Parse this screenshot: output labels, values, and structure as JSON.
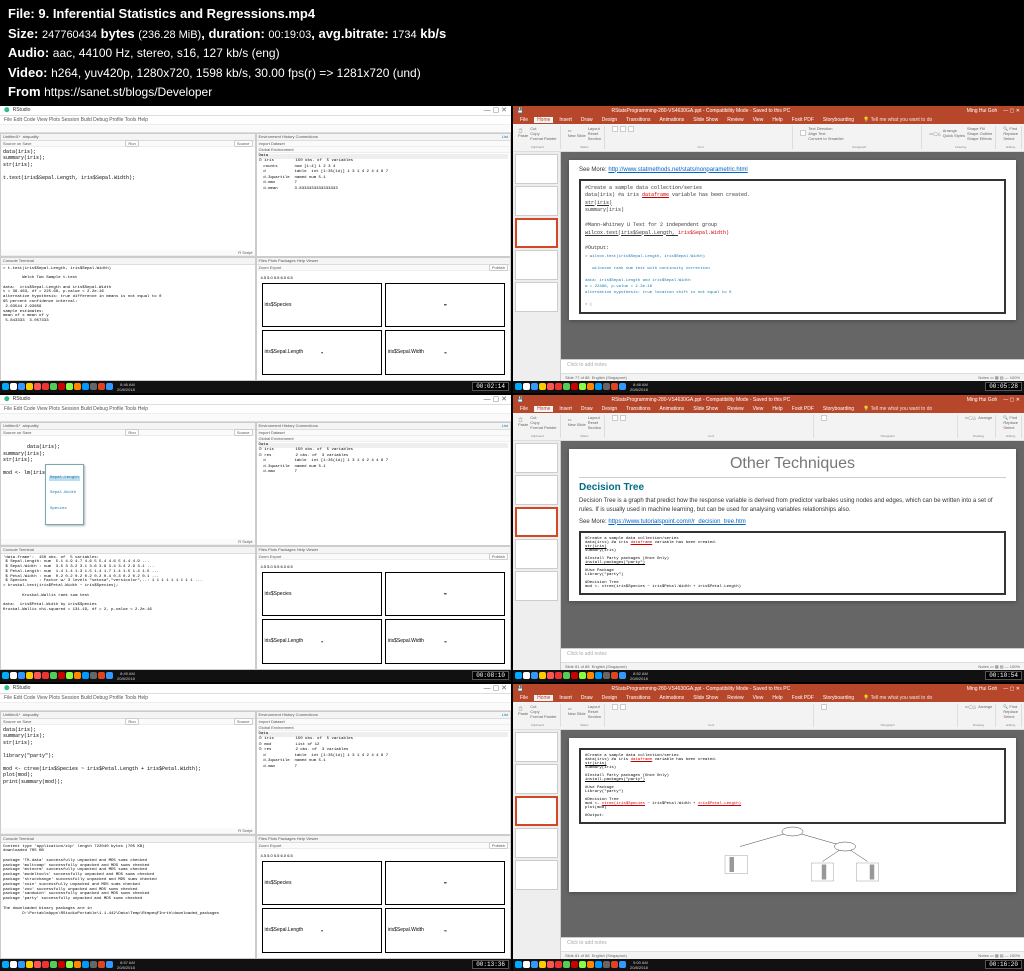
{
  "header": {
    "file_label": "File:",
    "file_name": "9. Inferential Statistics and Regressions.mp4",
    "size_label": "Size:",
    "size_bytes": "247760434",
    "size_unit": "bytes",
    "size_mib": "(236.28 MiB)",
    "duration_label": ", duration:",
    "duration": "00:19:03",
    "bitrate_label": ", avg.bitrate:",
    "bitrate": "1734",
    "bitrate_unit": "kb/s",
    "audio_label": "Audio:",
    "audio": "aac, 44100 Hz, stereo, s16, 127 kb/s (eng)",
    "video_label": "Video:",
    "video": "h264, yuv420p, 1280x720, 1598 kb/s, 30.00 fps(r) => 1281x720 (und)",
    "from_label": "From",
    "from_url": "https://sanet.st/blogs/Developer"
  },
  "rstudio": {
    "app_title": "RStudio",
    "menu": "File  Edit  Code  View  Plots  Session  Build  Debug  Profile  Tools  Help",
    "project_label": "Project: (None)",
    "source_tab": "Untitled1*",
    "source_tab2": "airquality",
    "source_on_save": "Source on Save",
    "run": "Run",
    "source": "Source",
    "env_tabs": "Environment   History   Connections",
    "import": "Import Dataset",
    "global_env": "Global Environment",
    "list": "List",
    "data_hdr": "Data",
    "values_hdr": "Values",
    "console_tabs": "Console   Terminal",
    "plots_tabs": "Files   Plots   Packages   Help   Viewer",
    "zoom": "Zoom",
    "export": "Export",
    "publish": "Publish",
    "rscript": "R Script"
  },
  "panel1": {
    "code": "data(iris);\nsummary(iris);\nstr(iris);\n\nt.test(iris$Sepal.Length, iris$Sepal.Width);",
    "console": "> t.test(iris$Sepal.Length, iris$Sepal.Width)\n\n        Welch Two Sample t-test\n\ndata:  iris$Sepal.Length and iris$Sepal.Width\nt = 36.463, df = 225.68, p-value < 2.2e-16\nalternative hypothesis: true difference in means is not equal to 0\n95 percent confidence interval:\n 2.63544 2.93656\nsample estimates:\nmean of x mean of y\n 5.843333  3.057333",
    "env": "⊙ iris         150 obs. of  5 variables\n  counts       num [1:4] 1 2 3 4\n  d            table  int [1:35(1d)] 1 3 1 4 2 4 4 6 7\n  d.3quartile  named num 5.1\n  d.max        7\n  d.mean       3.8333333333333333",
    "plot1": "iris$Species",
    "plot2": "iris$Sepal.Length",
    "plot3": "iris$Sepal.Width",
    "axis": "4.5  5.0  5.5  6.0  6.5",
    "timestamp": "00:02:14",
    "clock": "8:46 AM\n20/8/2018"
  },
  "panel2": {
    "code": "data(iris);\nsummary(iris);\nstr(iris);\n\nmod <- lm(iris$",
    "hint1": "Sepal.Length",
    "hint2": "Sepal.Width",
    "hint3": "Species",
    "console": "'data.frame':  150 obs. of  5 variables:\n $ Sepal.Length: num  5.1 4.9 4.7 4.6 5 5.4 4.6 5 4.4 4.9 ...\n $ Sepal.Width : num  3.5 3 3.2 3.1 3.6 3.9 3.4 3.4 2.9 3.1 ...\n $ Petal.Length: num  1.4 1.4 1.3 1.5 1.4 1.7 1.4 1.5 1.4 1.5 ...\n $ Petal.Width : num  0.2 0.2 0.2 0.2 0.2 0.4 0.3 0.2 0.2 0.1 ...\n $ Species     : Factor w/ 3 levels \"setosa\",\"versicolor\",..: 1 1 1 1 1 1 1 1 1 ...\n> kruskal.test(iris$Petal.Width ~ iris$Species);\n\n        Kruskal-Wallis rank sum test\n\ndata:  iris$Petal.Width by iris$Species\nKruskal-Wallis chi-squared = 131.19, df = 2, p-value < 2.2e-16",
    "env": "⊙ iris         150 obs. of  5 variables\n⊙ res          2 obs. of  3 variables\n  d            table  int [1:35(1d)] 1 3 1 4 2 4 4 6 7\n  d.3quartile  named num 5.1\n  d.max        7",
    "plot1": "iris$Species",
    "plot2": "iris$Sepal.Length",
    "plot3": "iris$Sepal.Width",
    "axis": "4.5  5.0  5.5  6.0  6.5",
    "timestamp": "00:08:10",
    "clock": "8:49 AM\n20/8/2018"
  },
  "panel3": {
    "code": "data(iris);\nsummary(iris);\nstr(iris);\n\nlibrary(\"party\");\n\nmod <- ctree(iris$Species ~ iris$Petal.Length + iris$Petal.Width);\nplot(mod);\nprint(summary(mod));",
    "console": "Content type 'application/zip' length 722040 bytes (705 KB)\ndownloaded 705 KB\n\npackage 'TH.data' successfully unpacked and MD5 sums checked\npackage 'multcomp' successfully unpacked and MD5 sums checked\npackage 'mvtnorm' successfully unpacked and MD5 sums checked\npackage 'modeltools' successfully unpacked and MD5 sums checked\npackage 'strucchange' successfully unpacked and MD5 sums checked\npackage 'coin' successfully unpacked and MD5 sums checked\npackage 'zoo' successfully unpacked and MD5 sums checked\npackage 'sandwich' successfully unpacked and MD5 sums checked\npackage 'party' successfully unpacked and MD5 sums checked\n\nThe downloaded binary packages are in\n        D:\\PortableApps\\RStudioPortable\\1.1.442\\Data\\Temp\\RtmpeqFInrth\\downloaded_packages",
    "env": "⊙ iris         150 obs. of  5 variables\n⊙ mod          List of 12\n⊙ res          2 obs. of  3 variables\n  d            table  int [1:35(1d)] 1 3 1 4 2 4 4 6 7\n  d.3quartile  named num 5.1\n  d.max        7",
    "plot1": "iris$Species",
    "plot2": "iris$Sepal.Length",
    "plot3": "iris$Sepal.Width",
    "axis": "4.5  5.0  5.5  6.0  6.5",
    "timestamp": "00:13:36",
    "clock": "8:57 AM\n20/8/2018"
  },
  "ppt": {
    "filename": "RStatsProgramming-280-VS4630GA.ppt - Compatibility Mode - Saved to this PC",
    "user": "Ming Hui Goh",
    "tabs": [
      "File",
      "Home",
      "Insert",
      "Draw",
      "Design",
      "Transitions",
      "Animations",
      "Slide Show",
      "Review",
      "View",
      "Help",
      "Foxit PDF",
      "Storyboarding"
    ],
    "tell_me": "Tell me what you want to do",
    "clipboard": "Clipboard",
    "cut": "Cut",
    "copy": "Copy",
    "format_painter": "Format Painter",
    "paste": "Paste",
    "slides": "Slides",
    "new_slide": "New Slide",
    "layout": "Layout",
    "reset": "Reset",
    "section": "Section",
    "font": "Font",
    "paragraph": "Paragraph",
    "drawing": "Drawing",
    "shapes": "Shapes",
    "arrange": "Arrange",
    "quick_styles": "Quick Styles",
    "shape_fill": "Shape Fill",
    "shape_outline": "Shape Outline",
    "shape_effects": "Shape Effects",
    "editing": "Editing",
    "find": "Find",
    "replace": "Replace",
    "select": "Select",
    "text_direction": "Text Direction",
    "align_text": "Align Text",
    "convert_smartart": "Convert to SmartArt",
    "notes": "Click to add notes",
    "english": "English (Singapore)",
    "notes_btn": "Notes",
    "zoom": "100%"
  },
  "ppt1": {
    "slide_of": "Slide 77 of 88",
    "see_more": "See More:",
    "see_url": "http://www.statmethods.net/stats/nonparametric.html",
    "c1": "#Create a sample data collection/series",
    "c2a": "data(iris) #a iris ",
    "c2b": "dataframe",
    "c2c": " variable has been created.",
    "c3": "str(iris)",
    "c4": "summary(iris)",
    "c5": "#Mann-Whitney U Test for 2 independent group",
    "c6a": "wilcox.test(iris$Sepal.Length, ",
    "c6b": "iris$Sepal.Width)",
    "c7": "#Output:",
    "out": "> wilcox.test(iris$Sepal.Length, iris$Sepal.Width)\n\n   wilcoxon rank sum test with continuity correction\n\ndata: iris$Sepal.Length and iris$Sepal.Width\nw = 22486, p-value < 2.2e-16\nalternative hypothesis: true location shift is not equal to 0\n\n> |",
    "timestamp": "00:05:28",
    "clock": "8:48 AM\n20/8/2018"
  },
  "ppt2": {
    "slide_of": "Slide 81 of 88",
    "title_top": "Other Techniques",
    "title": "Decision Tree",
    "body": "Decision Tree is a graph that predict how the response variable is derived from predictor varibales using nodes and edges, which can be written into a set of rules. If is usually used in machine learning, but can be used for analysing variables relationships also.",
    "see_more": "See More:",
    "see_url": "https://www.tutorialspoint.com/r/r_decision_tree.htm",
    "c1": "#Create a sample data collection/series",
    "c2a": "data(iris) #a iris ",
    "c2b": "dataframe",
    "c2c": " variable has been created.",
    "c3": "str(iris)",
    "c4": "summary(iris)",
    "c5": "#Install Party packages (Once Only)",
    "c6": "install.packages(\"party\")",
    "c7": "#Use Package",
    "c8": "Library(\"party\")",
    "c9": "#Decision Tree",
    "c10": "mod <- ctree(iris$Species ~ iris$Petal.Width + iris$Petal.Length)",
    "timestamp": "00:10:54",
    "clock": "8:52 AM\n20/8/2018"
  },
  "ppt3": {
    "slide_of": "Slide 81 of 88",
    "c1": "#Create a sample data collection/series",
    "c2a": "data(iris) #a iris ",
    "c2b": "dataframe",
    "c2c": " variable has been created.",
    "c3": "str(iris)",
    "c4": "summary(iris)",
    "c5": "#Install Party packages (Once Only)",
    "c6": "install.packages(\"party\")",
    "c7": "#Use Package",
    "c8": "Library(\"party\")",
    "c9": "#Decision Tree",
    "c10a": "mod <- ",
    "c10b": "ctree(iris$Species",
    "c10c": " ~ iris$Petal.Width + ",
    "c10d": "iris$Petal.Length)",
    "c11": "plot(mod)",
    "c12": "#Output:",
    "timestamp": "00:16:20",
    "clock": "9:00 AM\n20/8/2018"
  }
}
